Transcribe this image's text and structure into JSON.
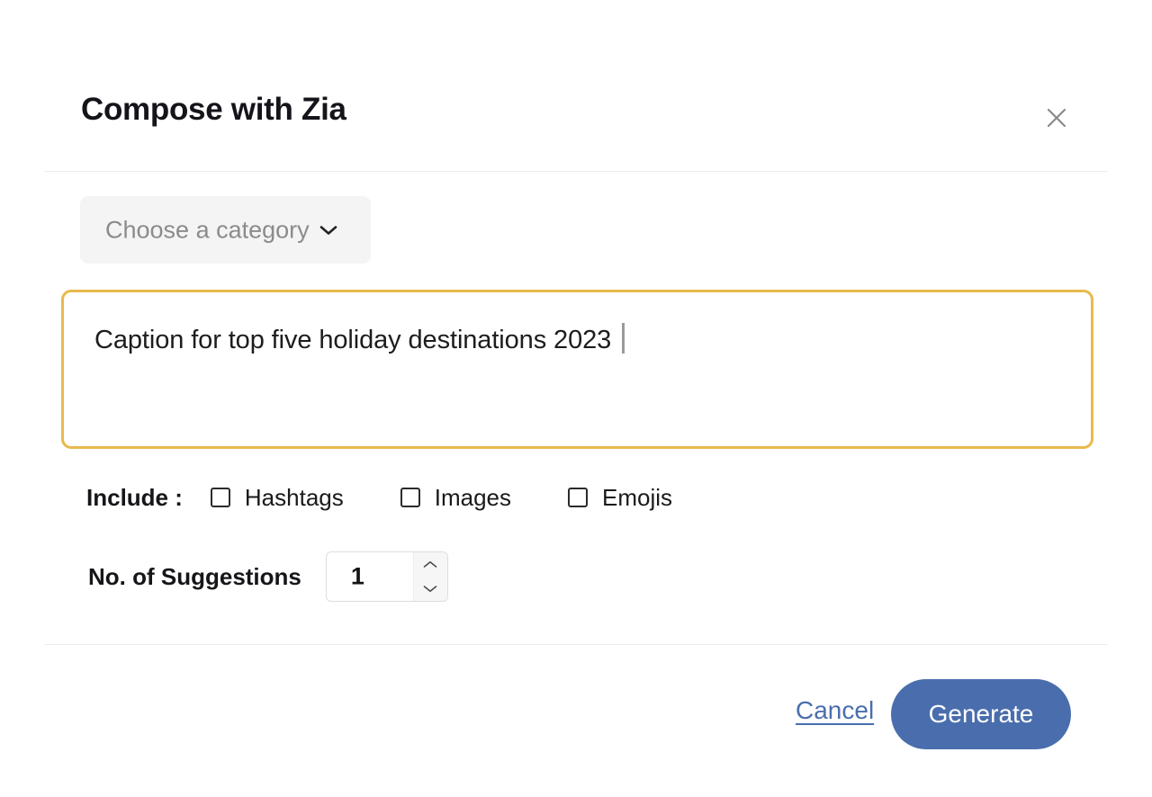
{
  "dialog": {
    "title": "Compose with Zia",
    "close_icon": "close-icon"
  },
  "category": {
    "placeholder": "Choose a category",
    "chevron_icon": "chevron-down-icon"
  },
  "prompt": {
    "value": "Caption for top five holiday destinations 2023",
    "border_color": "#e9b94c",
    "has_caret": true
  },
  "include": {
    "label": "Include :",
    "options": [
      {
        "label": "Hashtags",
        "checked": false
      },
      {
        "label": "Images",
        "checked": false
      },
      {
        "label": "Emojis",
        "checked": false
      }
    ]
  },
  "suggestions": {
    "label": "No. of Suggestions",
    "value": "1",
    "increment_icon": "chevron-up-icon",
    "decrement_icon": "chevron-down-icon"
  },
  "footer": {
    "cancel_label": "Cancel",
    "generate_label": "Generate",
    "accent_color": "#4a6ead"
  }
}
